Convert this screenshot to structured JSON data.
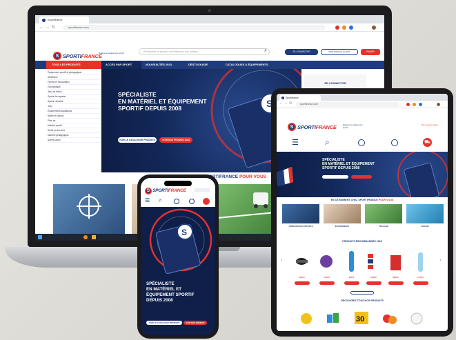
{
  "laptop": {
    "tab_title": "Sportifrance",
    "url": "sportifrance.com",
    "logo": {
      "main": "SPORTI",
      "accent": "FRANCE",
      "tagline": "Matériel et équipement sportif"
    },
    "search_placeholder": "Rechercher un produit, une référence, une marque...",
    "connect_label": "SE CONNECTER",
    "account_label": "MON ESPACE CLIENT",
    "cart_label": "PANIER",
    "nav": [
      "ACCÈS PAR SPORT",
      "NOUVEAUTÉS 2023",
      "DÉSTOCKAGE",
      "CATALOGUES & ÉQUIPEMENTS"
    ],
    "sidebar_header": "TOUS LES PRODUITS",
    "sidebar_items": [
      "Équipement sportif et pédagogique",
      "Athlétisme",
      "Fitness et musculation",
      "Gymnastique",
      "Jeux de ballon",
      "Sports de raquette",
      "Sports collectifs",
      "Judo",
      "Équipements aquatiques",
      "Balles et ballons",
      "Plein air",
      "Mobilier sportif",
      "Santé et bien-être",
      "Matériel pédagogique",
      "Autres sports"
    ],
    "hero_title_lines": [
      "SPÉCIALISTE",
      "EN MATÉRIEL ET ÉQUIPEMENT",
      "SPORTIF DEPUIS 2008"
    ],
    "hero_btn_catalog": "VOIR LE CATALOGUE PRODUITS",
    "hero_btn_promo": "VOIR NOS PROMOS 2023",
    "right_panel_title": "SE CONNECTER",
    "section_title": "EN CE MOMENT CHEZ SPORTIFRANCE",
    "section_title_accent": "POUR VOUS",
    "cards": [
      {
        "caption": "TERRAINS MULTISPORTS"
      },
      {
        "caption": "ÉQUIPEMENTS DE GYMNASTIQUE"
      },
      {
        "caption": "TRAÇAGE DES TERRAINS DE SPORTS"
      }
    ],
    "status_bar": "Réseaux ou matériel sportif à des prix professionnels"
  },
  "tablet": {
    "tab_title": "Sportifrance",
    "url": "sportifrance.com",
    "logo": {
      "main": "SPORTI",
      "accent": "FRANCE"
    },
    "tagline": "Matériel et équipement sportif",
    "account_label": "Mon espace client",
    "hero_title_lines": [
      "SPÉCIALISTE",
      "EN MATÉRIEL ET ÉQUIPEMENT",
      "SPORTIF DEPUIS 2008"
    ],
    "section1": "EN CE MOMENT CHEZ SPORTIFRANCE",
    "section1_accent": "POUR VOUS",
    "cards": [
      "TERRAINS MULTISPORTS",
      "ÉQUIPEMENTS",
      "TRAÇAGE",
      "PISCINE"
    ],
    "section2": "PRODUITS RECOMMANDÉS 2023",
    "prices": [
      "24,90 €",
      "12,50 €",
      "8,90 €",
      "16,00 €",
      "39,90 €",
      "21,50 €"
    ],
    "section3": "DÉCOUVREZ TOUS NOS PRODUITS",
    "colors": {
      "navy": "#1f3b7a",
      "red": "#e5322d"
    }
  },
  "phone": {
    "logo": {
      "main": "SPORTI",
      "accent": "FRANCE"
    },
    "hero_title_lines": [
      "SPÉCIALISTE",
      "EN MATÉRIEL ET",
      "ÉQUIPEMENT SPORTIF",
      "DEPUIS 2008"
    ],
    "btn_catalog": "VOIR LE CATALOGUE PRODUITS",
    "btn_promo": "VOIR NOS PROMOS"
  }
}
